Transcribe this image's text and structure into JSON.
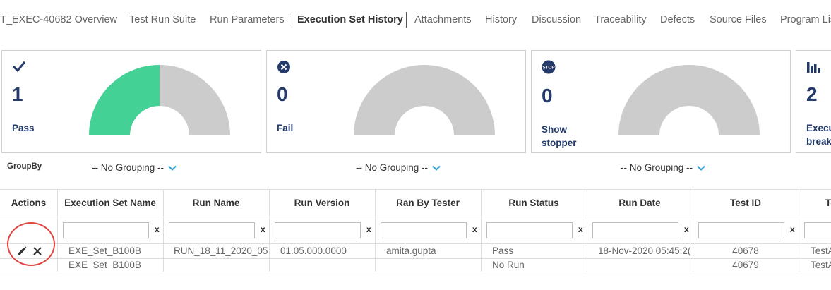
{
  "tabs": [
    {
      "label": "T_EXEC-40682 Overview"
    },
    {
      "label": "Test Run Suite"
    },
    {
      "label": "Run Parameters"
    },
    {
      "label": "Execution Set History"
    },
    {
      "label": "Attachments"
    },
    {
      "label": "History"
    },
    {
      "label": "Discussion"
    },
    {
      "label": "Traceability"
    },
    {
      "label": "Defects"
    },
    {
      "label": "Source Files"
    },
    {
      "label": "Program Lis"
    }
  ],
  "active_tab": "Execution Set History",
  "cards": [
    {
      "count": "1",
      "label": "Pass",
      "icon": "check-icon",
      "gauge_fraction": 0.5,
      "gauge_color": "#44d195"
    },
    {
      "count": "0",
      "label": "Fail",
      "icon": "close-circle-icon",
      "gauge_fraction": 0,
      "gauge_color": "#44d195"
    },
    {
      "count": "0",
      "label": "Show stopper",
      "icon": "stop-icon",
      "icon_text": "STOP",
      "gauge_fraction": 0,
      "gauge_color": "#44d195"
    },
    {
      "count": "2",
      "label": "Execu\nbreak",
      "icon": "bar-chart-icon"
    }
  ],
  "colors": {
    "accent": "#233a6b",
    "gauge_gray": "#cccccc",
    "pass_green": "#44d195",
    "chevron": "#2a9fd8",
    "highlight": "#e0443e"
  },
  "groupby": {
    "label": "GroupBy",
    "options": [
      "-- No Grouping --",
      "-- No Grouping --",
      "-- No Grouping --"
    ]
  },
  "table": {
    "columns": [
      "Actions",
      "Execution Set Name",
      "Run Name",
      "Run Version",
      "Ran By Tester",
      "Run Status",
      "Run Date",
      "Test ID",
      "Te"
    ],
    "filter_clear": "x",
    "rows": [
      [
        "",
        "EXE_Set_B100B",
        "RUN_18_11_2020_05",
        "01.05.000.0000",
        "amita.gupta",
        "Pass",
        "18-Nov-2020 05:45:2(",
        "40678",
        "TestA"
      ],
      [
        "",
        "EXE_Set_B100B",
        "",
        "",
        "",
        "No Run",
        "",
        "40679",
        "TestA"
      ]
    ]
  }
}
